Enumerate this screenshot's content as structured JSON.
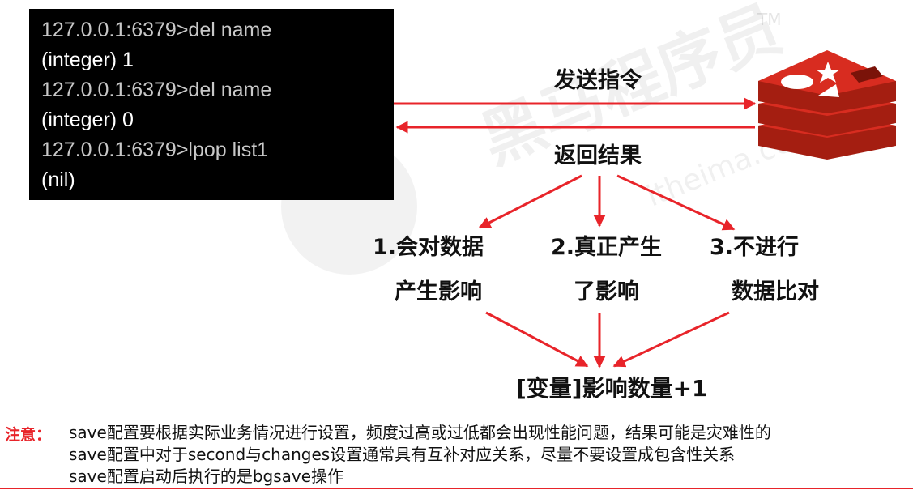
{
  "terminal": {
    "lines": [
      {
        "text": "127.0.0.1:6379>del name",
        "kind": "cmd"
      },
      {
        "text": "(integer) 1",
        "kind": "out"
      },
      {
        "text": "127.0.0.1:6379>del name",
        "kind": "cmd"
      },
      {
        "text": "(integer) 0",
        "kind": "out"
      },
      {
        "text": "127.0.0.1:6379>lpop list1",
        "kind": "out"
      },
      {
        "text": "(nil)",
        "kind": "out"
      }
    ]
  },
  "diagram": {
    "send_label": "发送指令",
    "return_label": "返回结果",
    "branch1_line1": "1.会对数据",
    "branch1_line2": "产生影响",
    "branch2_line1": "2.真正产生",
    "branch2_line2": "了影响",
    "branch3_line1": "3.不进行",
    "branch3_line2": "数据比对",
    "result_label": "[变量]影响数量+1",
    "arrow_color": "#e8242a"
  },
  "icons": {
    "server": "redis-logo-icon"
  },
  "notes": {
    "label": "注意：",
    "lines": [
      "save配置要根据实际业务情况进行设置，频度过高或过低都会出现性能问题，结果可能是灾难性的",
      "save配置中对于second与changes设置通常具有互补对应关系，尽量不要设置成包含性关系",
      "save配置启动后执行的是bgsave操作"
    ]
  },
  "watermark": {
    "brand": "黑马程序员",
    "tm": "TM",
    "url": "itheima.com"
  }
}
